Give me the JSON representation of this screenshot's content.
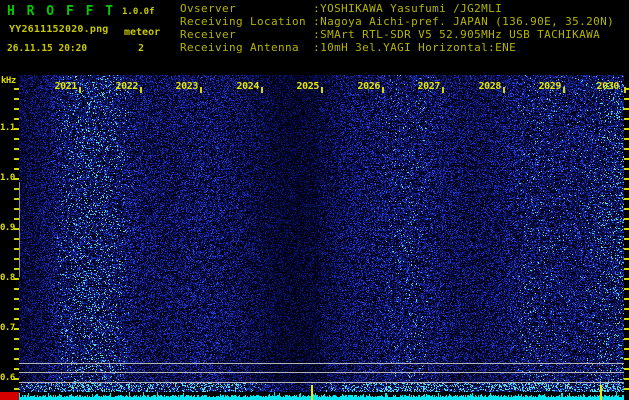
{
  "app": {
    "name": "H R O F F T",
    "version": "1.0.0f"
  },
  "session": {
    "filename": "YY2611152020.png",
    "datetime": "26.11.15 20:20",
    "mode_label": "meteor",
    "meteor_count": "2"
  },
  "station_info": {
    "lines": [
      {
        "label": "Ovserver           ",
        "value": ":YOSHIKAWA Yasufumi /JG2MLI"
      },
      {
        "label": "Receiving Location ",
        "value": ":Nagoya Aichi-pref. JAPAN (136.90E, 35.20N)"
      },
      {
        "label": "Receiver           ",
        "value": ":SMArt RTL-SDR V5 52.905MHz USB TACHIKAWA"
      },
      {
        "label": "Receiving Antenna  ",
        "value": ":10mH 3el.YAGI Horizontal:ENE"
      }
    ]
  },
  "spectrogram": {
    "y_axis_unit": "kHz",
    "y_tick_labels": [
      "1.1",
      "1.0",
      "0.9",
      "0.8",
      "0.7",
      "0.6"
    ],
    "x_tick_labels": [
      "2021",
      "2022",
      "2023",
      "2024",
      "2025",
      "2026",
      "2027",
      "2028",
      "2029",
      "2030"
    ],
    "reference_line_ys": [
      363,
      372,
      382
    ],
    "event_marker_xs": [
      311,
      600
    ],
    "colors": {
      "label_yellow": "#e8e800",
      "text_yellow": "#c8c800",
      "title_green": "#00cc00",
      "amplitude_cyan": "#00e6f2",
      "corner_red": "#d40000",
      "reference_gray": "#b4b4bc"
    }
  }
}
